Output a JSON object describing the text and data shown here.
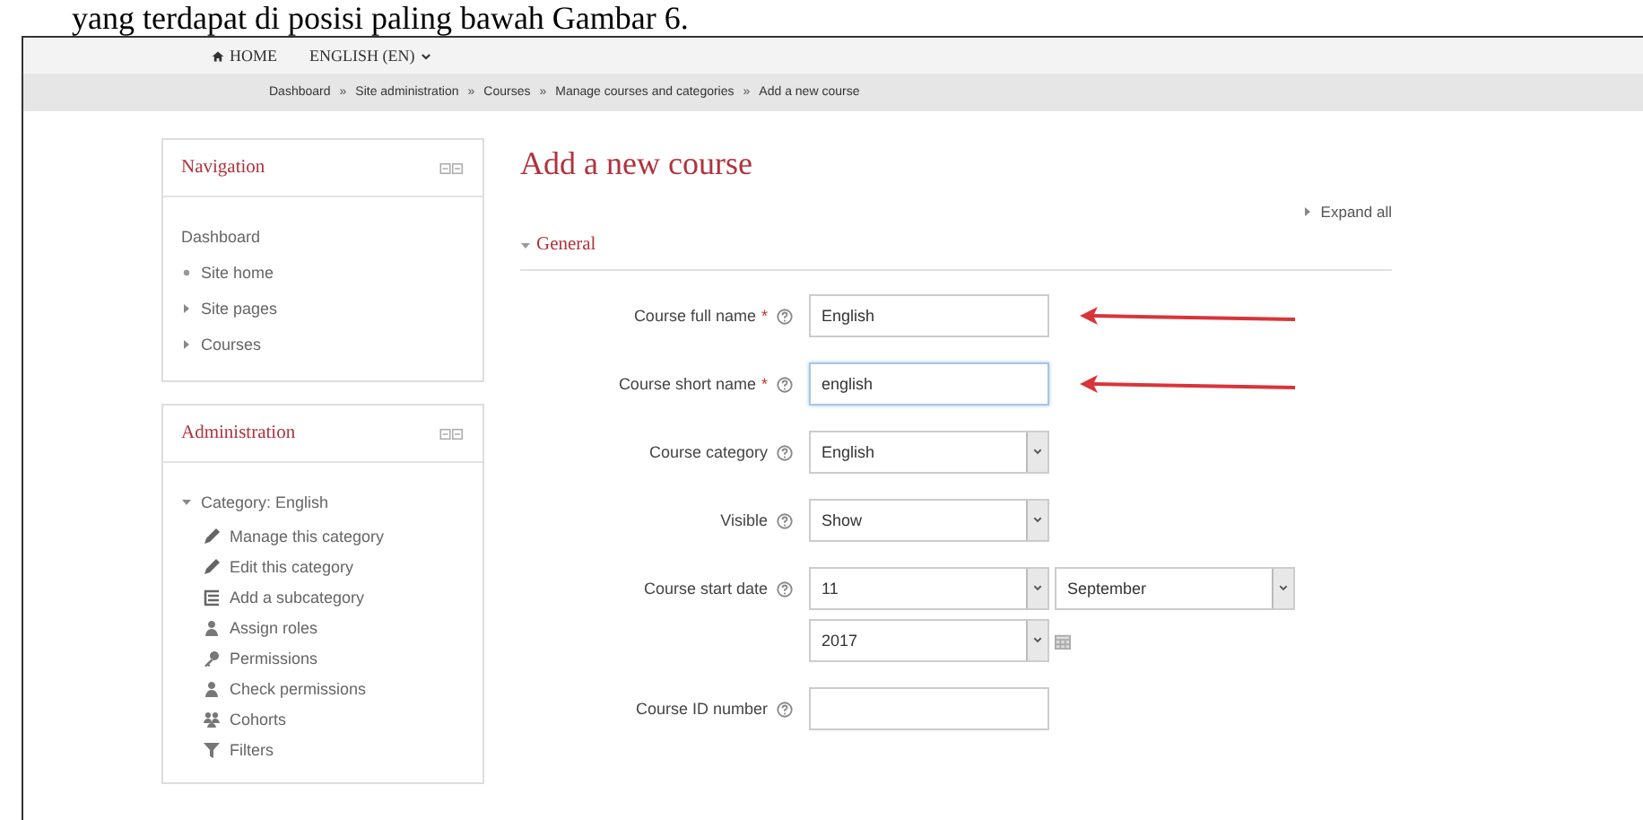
{
  "document_caption": "yang terdapat di posisi paling bawah Gambar 6.",
  "top_menu": [
    {
      "kind": "home",
      "label": "HOME"
    },
    {
      "kind": "dropdown",
      "label": "ENGLISH (EN)"
    }
  ],
  "breadcrumb": {
    "items": [
      "Dashboard",
      "Site administration",
      "Courses",
      "Manage courses and categories",
      "Add a new course"
    ],
    "separator": "»"
  },
  "blocks": [
    {
      "title": "Navigation",
      "items": [
        {
          "kind": "plain",
          "label": "Dashboard"
        },
        {
          "kind": "leaf",
          "label": "Site home"
        },
        {
          "kind": "branch",
          "label": "Site pages",
          "expanded": false
        },
        {
          "kind": "branch",
          "label": "Courses",
          "expanded": false
        }
      ]
    },
    {
      "title": "Administration",
      "items": [
        {
          "kind": "branch",
          "label": "Category: English",
          "expanded": true,
          "children": [
            {
              "kind": "pencil",
              "label": "Manage this category"
            },
            {
              "kind": "pencil",
              "label": "Edit this category"
            },
            {
              "kind": "list",
              "label": "Add a subcategory"
            },
            {
              "kind": "person",
              "label": "Assign roles"
            },
            {
              "kind": "key",
              "label": "Permissions"
            },
            {
              "kind": "person",
              "label": "Check permissions"
            },
            {
              "kind": "group",
              "label": "Cohorts"
            },
            {
              "kind": "filter",
              "label": "Filters"
            }
          ]
        }
      ]
    }
  ],
  "page_title": "Add a new course",
  "expand_all": "Expand all",
  "section": {
    "title": "General",
    "expanded": true
  },
  "fields": [
    {
      "kind": "text",
      "label": "Course full name",
      "required_mark": "*",
      "value": "English",
      "annotated": true,
      "focused": false
    },
    {
      "kind": "text",
      "label": "Course short name",
      "required_mark": "*",
      "value": "english",
      "annotated": true,
      "focused": true
    },
    {
      "kind": "select",
      "label": "Course category",
      "value": "English"
    },
    {
      "kind": "select",
      "label": "Visible",
      "value": "Show"
    },
    {
      "kind": "date",
      "label": "Course start date",
      "day": "11",
      "month": "September",
      "year": "2017"
    },
    {
      "kind": "text",
      "label": "Course ID number",
      "annotated": false,
      "focused": false
    }
  ]
}
